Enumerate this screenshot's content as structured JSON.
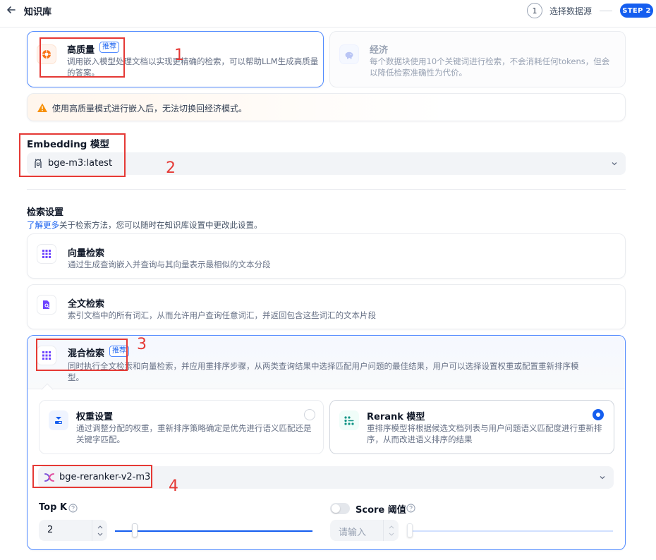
{
  "header": {
    "title": "知识库",
    "step1_number": "1",
    "step1_label": "选择数据源",
    "step2_label": "STEP 2"
  },
  "index_mode": {
    "high_quality": {
      "title": "高质量",
      "tag": "推荐",
      "desc": "调用嵌入模型处理文档以实现更精确的检索，可以帮助LLM生成高质量的答案。",
      "selected": true
    },
    "economy": {
      "title": "经济",
      "desc": "每个数据块使用10个关键词进行检索，不会消耗任何tokens，但会以降低检索准确性为代价。",
      "disabled": true
    }
  },
  "warning": {
    "text": "使用高质量模式进行嵌入后，无法切换回经济模式。"
  },
  "embedding": {
    "label": "Embedding 模型",
    "model": "bge-m3:latest"
  },
  "retrieval": {
    "title": "检索设置",
    "learn_more": "了解更多",
    "desc_rest": "关于检索方法，您可以随时在知识库设置中更改此设置。",
    "vector": {
      "title": "向量检索",
      "desc": "通过生成查询嵌入并查询与其向量表示最相似的文本分段"
    },
    "fulltext": {
      "title": "全文检索",
      "desc": "索引文档中的所有词汇，从而允许用户查询任意词汇，并返回包含这些词汇的文本片段"
    },
    "hybrid": {
      "title": "混合检索",
      "tag": "推荐",
      "desc_line1": "同时执行全文检索和向量检索，并应用重排序步骤，从两类查询结果中选择匹配用户问题的最佳结果，用户可以选择设置权重或配置重新排序模",
      "desc_line2": "型。",
      "selected": true,
      "weight": {
        "title": "权重设置",
        "desc": "通过调整分配的权重，重新排序策略确定是优先进行语义匹配还是关键字匹配。",
        "selected": false
      },
      "rerank": {
        "title": "Rerank 模型",
        "desc": "重排序模型将根据候选文档列表与用户问题语义匹配度进行重新排序，从而改进语义排序的结果",
        "selected": true
      },
      "rerank_model": "bge-reranker-v2-m3",
      "top_k": {
        "label": "Top K",
        "value": "2",
        "slider_fraction": 0.1
      },
      "score": {
        "label": "Score 阈值",
        "placeholder": "请输入",
        "enabled": false
      }
    }
  },
  "annotations": {
    "n1": "1",
    "n2": "2",
    "n3": "3",
    "n4": "4"
  },
  "colors": {
    "primary": "#155eef",
    "annotation": "#e53935",
    "warning": "#f79009"
  }
}
